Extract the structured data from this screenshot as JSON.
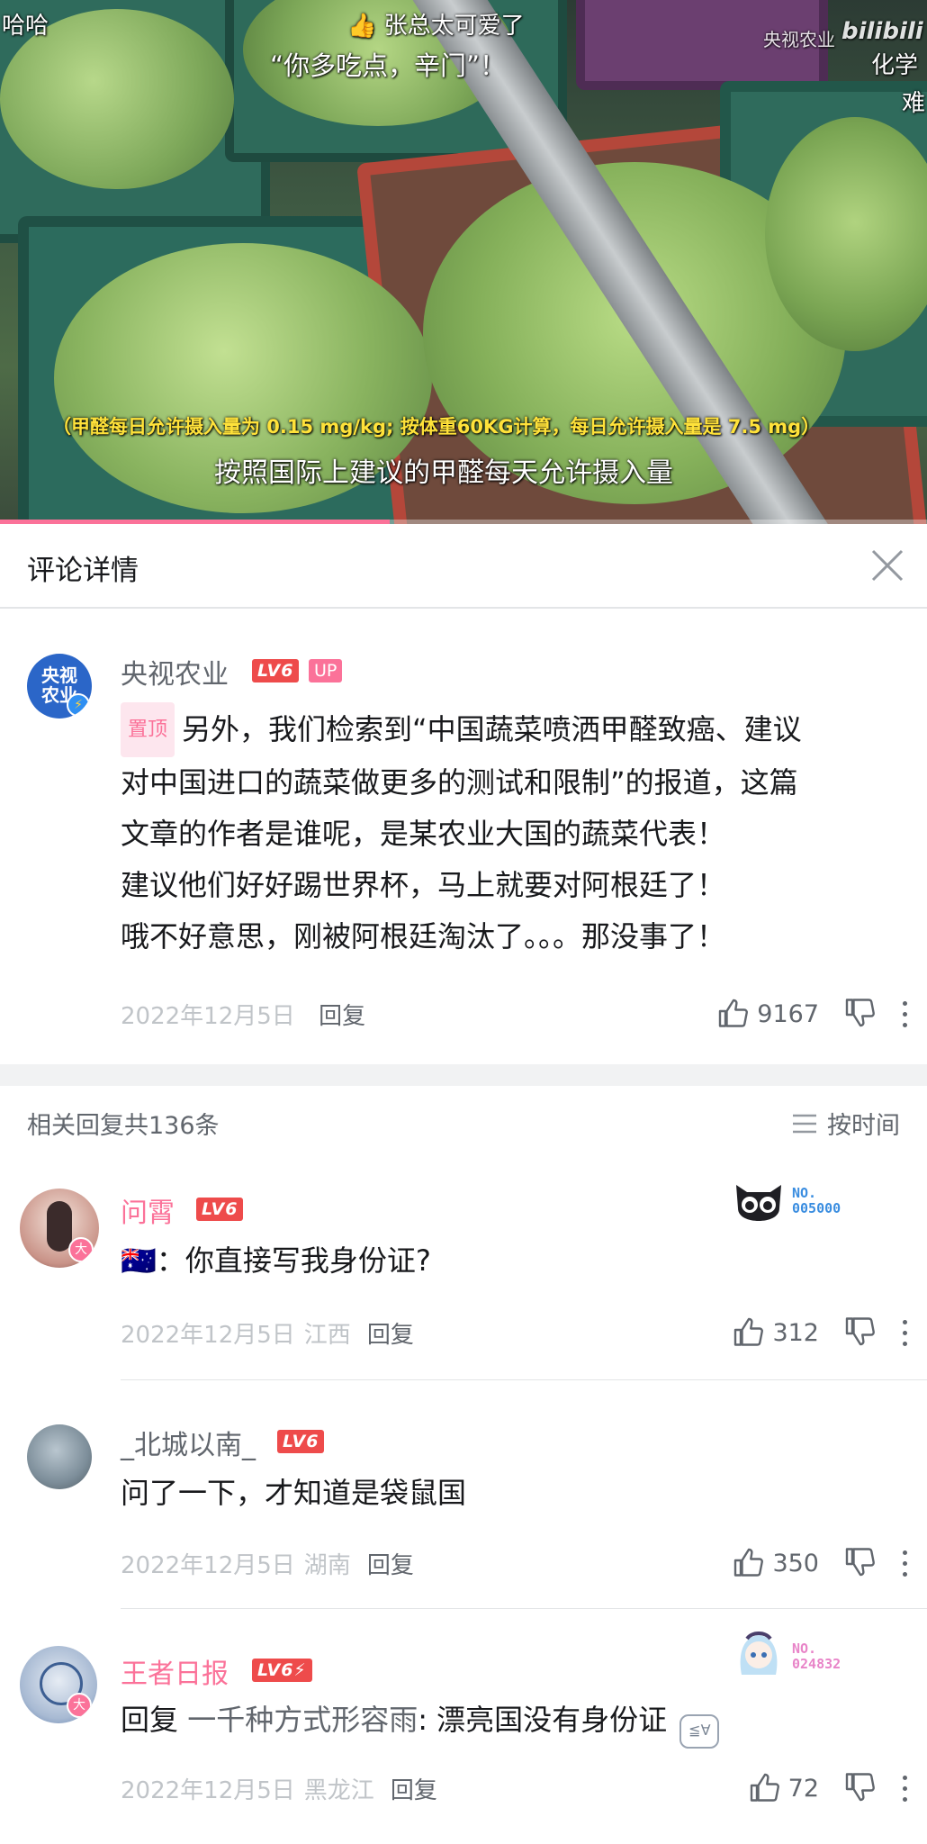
{
  "video": {
    "top_left_text": "哈哈",
    "danmaku_1": "张总太可爱了",
    "danmaku_2": "“你多吃点，辛门”！",
    "watermark_channel": "央视农业",
    "watermark_site": "bilibili",
    "right_edge_text_1": "化学",
    "right_edge_text_2": "难",
    "subtitle_note": "（甲醛每日允许摄入量为 0.15 mg/kg; 按体重60KG计算，每日允许摄入量是 7.5 mg）",
    "subtitle_main": "按照国际上建议的甲醛每天允许摄入量",
    "progress": 0.42,
    "accent_color": "#fb7299"
  },
  "panel": {
    "title": "评论详情",
    "close_icon": "close-icon"
  },
  "main_comment": {
    "username": "央视农业",
    "level": "LV6",
    "up_badge": "UP",
    "avatar_text": "央视\n农业",
    "pin_label": "置顶",
    "lines": [
      "另外，我们检索到“中国蔬菜喷洒甲醛致癌、建议",
      "对中国进口的蔬菜做更多的测试和限制”的报道，这篇",
      "文章的作者是谁呢，是某农业大国的蔬菜代表！",
      "建议他们好好踢世界杯，马上就要对阿根廷了！",
      "哦不好意思，刚被阿根廷淘汰了。。。那没事了！"
    ],
    "date": "2022年12月5日",
    "reply_label": "回复",
    "likes": "9167"
  },
  "replies_header": {
    "count_text": "相关回复共136条",
    "sort_label": "按时间"
  },
  "replies": [
    {
      "username": "问霄",
      "level": "LV6",
      "name_color": "#fb7299",
      "content": "🇦🇺：你直接写我身份证?",
      "date": "2022年12月5日",
      "location": "江西",
      "reply_label": "回复",
      "likes": "312",
      "fan_no_label": "NO.",
      "fan_no": "005000",
      "fan_color": "#3a8de0"
    },
    {
      "username": "_北城以南_",
      "level": "LV6",
      "name_color": "#61666d",
      "content": "问了一下，才知道是袋鼠国",
      "date": "2022年12月5日",
      "location": "湖南",
      "reply_label": "回复",
      "likes": "350"
    },
    {
      "username": "王者日报",
      "level": "LV6",
      "name_color": "#fb7299",
      "reply_prefix": "回复 ",
      "reply_to": "一千种方式形容雨",
      "content": ": 漂亮国没有身份证",
      "date": "2022年12月5日",
      "location": "黑龙江",
      "reply_label": "回复",
      "likes": "72",
      "fan_no_label": "NO.",
      "fan_no": "024832",
      "fan_color": "#e884c8"
    }
  ]
}
